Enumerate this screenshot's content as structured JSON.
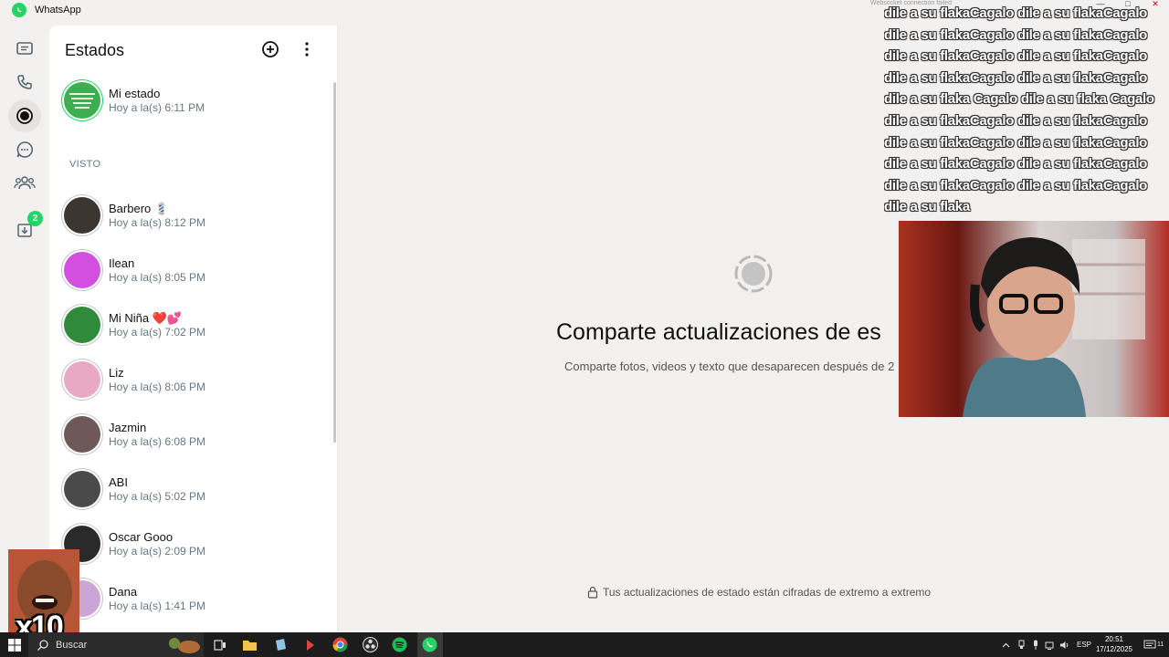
{
  "app": {
    "title": "WhatsApp",
    "connection_note": "Websocket connection failed"
  },
  "window_controls": {
    "minimize": "—",
    "maximize": "□",
    "close": "✕"
  },
  "rail": {
    "items": [
      {
        "name": "chats",
        "icon": "chat-list-icon"
      },
      {
        "name": "calls",
        "icon": "phone-icon"
      },
      {
        "name": "status",
        "icon": "status-icon",
        "active": true
      },
      {
        "name": "channels",
        "icon": "channels-icon"
      },
      {
        "name": "communities",
        "icon": "communities-icon"
      },
      {
        "name": "archived",
        "icon": "archive-icon",
        "badge": "2"
      }
    ]
  },
  "panel": {
    "title": "Estados",
    "my_status": {
      "name": "Mi estado",
      "time": "Hoy a la(s) 6:11 PM"
    },
    "section_label": "VISTO",
    "contacts": [
      {
        "name": "Barbero 💈",
        "time": "Hoy a la(s) 8:12 PM",
        "color": "#3b3632"
      },
      {
        "name": "Ilean",
        "time": "Hoy a la(s) 8:05 PM",
        "color": "#d24fe0"
      },
      {
        "name": "Mi Niña ❤️💕",
        "time": "Hoy a la(s) 7:02 PM",
        "color": "#2f8a3c"
      },
      {
        "name": "Liz",
        "time": "Hoy a la(s) 8:06 PM",
        "color": "#e9a9c4"
      },
      {
        "name": "Jazmin",
        "time": "Hoy a la(s) 6:08 PM",
        "color": "#6e5858"
      },
      {
        "name": "ABI",
        "time": "Hoy a la(s) 5:02 PM",
        "color": "#4a4a4a"
      },
      {
        "name": "Oscar Gooo",
        "time": "Hoy a la(s) 2:09 PM",
        "color": "#2a2a2a"
      },
      {
        "name": "Dana",
        "time": "Hoy a la(s) 1:41 PM",
        "color": "#c9a6d6"
      }
    ]
  },
  "main": {
    "heading": "Comparte actualizaciones de es",
    "subtext": "Comparte fotos, videos y texto que desaparecen después de 2",
    "encryption_note": "Tus actualizaciones de estado están cifradas de extremo a extremo"
  },
  "overlay": {
    "lines": [
      "dile a su flakaCagalo dile a su flakaCagalo",
      "dile a su flakaCagalo dile a su flakaCagalo",
      "dile a su flakaCagalo dile a su flakaCagalo",
      "dile a su flakaCagalo dile a su flakaCagalo",
      "dile a su flaka Cagalo dile a su flaka Cagalo",
      "dile a su flakaCagalo dile a su flakaCagalo",
      "dile a su flakaCagalo dile a su flakaCagalo",
      "dile a su flakaCagalo dile a su flakaCagalo",
      "dile a su flakaCagalo dile a su flakaCagalo",
      "dile a su flaka"
    ],
    "meme_label": "x10"
  },
  "taskbar": {
    "search_label": "Buscar",
    "language": "ESP",
    "clock_time": "20:51",
    "clock_date": "17/12/2025",
    "notification_count": "11"
  }
}
